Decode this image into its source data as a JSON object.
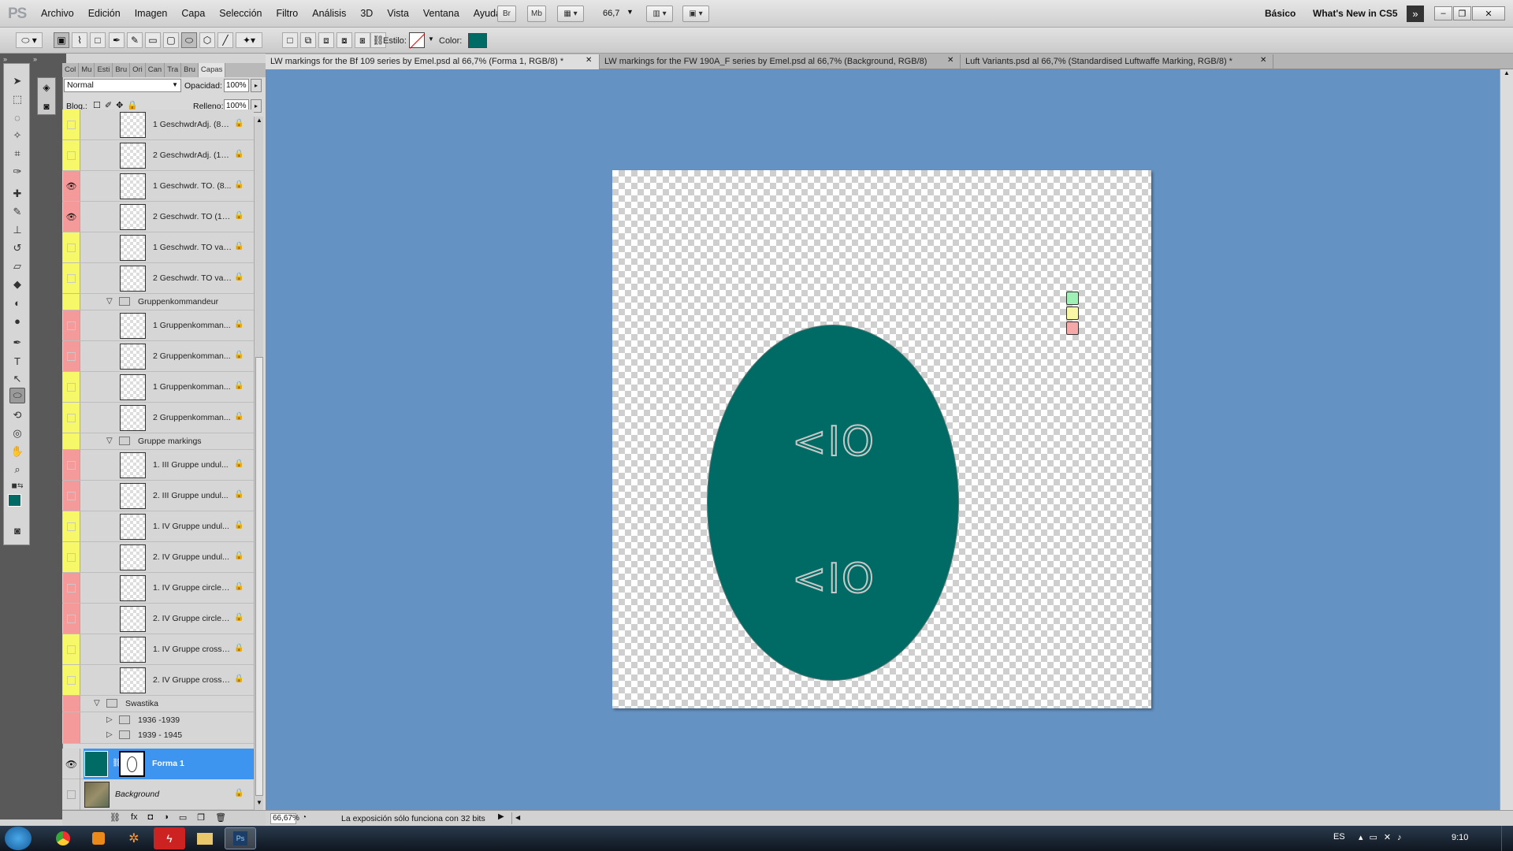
{
  "app": {
    "logo": "PS"
  },
  "menu": [
    "Archivo",
    "Edición",
    "Imagen",
    "Capa",
    "Selección",
    "Filtro",
    "Análisis",
    "3D",
    "Vista",
    "Ventana",
    "Ayuda"
  ],
  "menubar_buttons": {
    "bridge": "Br",
    "mini_bridge": "Mb",
    "zoom": "66,7"
  },
  "workspace": {
    "basic": "Básico",
    "whats_new": "What's New in CS5"
  },
  "options": {
    "style_label": "Estilo:",
    "color_label": "Color:",
    "color_value": "#006b64"
  },
  "panel": {
    "tabs": [
      "Col",
      "Mu",
      "Esti",
      "Bru",
      "Ori",
      "Can",
      "Tra",
      "Bru",
      "Capas"
    ],
    "blend_mode": "Normal",
    "opacity_label": "Opacidad:",
    "opacity_value": "100%",
    "lock_label": "Bloq.:",
    "fill_label": "Relleno:",
    "fill_value": "100%"
  },
  "layers": [
    {
      "name": "1 GeschwdrAdj. (85...",
      "color": "#f7f76a",
      "eye": false
    },
    {
      "name": "2 GeschwdrAdj. (15...",
      "color": "#f7f76a",
      "eye": false
    },
    {
      "name": "1 Geschwdr. TO. (8...",
      "color": "#f49a9a",
      "eye": true
    },
    {
      "name": "2 Geschwdr. TO (15...",
      "color": "#f49a9a",
      "eye": true
    },
    {
      "name": "1 Geschwdr. TO var...",
      "color": "#f7f76a",
      "eye": false
    },
    {
      "name": "2 Geschwdr. TO var...",
      "color": "#f7f76a",
      "eye": false
    }
  ],
  "group_gk": {
    "name": "Gruppenkommandeur",
    "color": "#f7f76a"
  },
  "layers_gk": [
    {
      "name": "1 Gruppenkomman...",
      "color": "#f49a9a"
    },
    {
      "name": "2 Gruppenkomman...",
      "color": "#f49a9a"
    },
    {
      "name": "1 Gruppenkomman...",
      "color": "#f7f76a"
    },
    {
      "name": "2 Gruppenkomman...",
      "color": "#f7f76a"
    }
  ],
  "group_gm": {
    "name": "Gruppe markings",
    "color": "#f7f76a"
  },
  "layers_gm": [
    {
      "name": "1. III Gruppe undul...",
      "color": "#f49a9a"
    },
    {
      "name": "2. III Gruppe undul...",
      "color": "#f49a9a"
    },
    {
      "name": "1. IV Gruppe undul...",
      "color": "#f7f76a"
    },
    {
      "name": "2. IV Gruppe undul...",
      "color": "#f7f76a"
    },
    {
      "name": "1. IV Gruppe circle (...",
      "color": "#f49a9a"
    },
    {
      "name": "2. IV Gruppe circle (...",
      "color": "#f49a9a"
    },
    {
      "name": "1. IV Gruppe cross (...",
      "color": "#f7f76a"
    },
    {
      "name": "2. IV Gruppe cross (...",
      "color": "#f7f76a"
    }
  ],
  "group_sw": {
    "name": "Swastika",
    "color": "#f49a9a"
  },
  "subgroups": [
    {
      "name": "1936 -1939",
      "color": "#f49a9a"
    },
    {
      "name": "1939 - 1945",
      "color": "#f49a9a"
    }
  ],
  "active_layer": {
    "name": "Forma 1"
  },
  "background_layer": {
    "name": "Background"
  },
  "doc_tabs": [
    "LW markings for the Bf 109 series by Emel.psd al 66,7% (Forma 1, RGB/8) *",
    "LW markings for the FW 190A_F series  by Emel.psd al 66,7% (Background, RGB/8)",
    "Luft Variants.psd al 66,7% (Standardised Luftwaffe Marking, RGB/8) *"
  ],
  "canvas": {
    "mark_top": "<IO",
    "mark_bottom": "<IO",
    "swatch_colors": [
      "#9ef0b4",
      "#f7f7a6",
      "#f4a8a8"
    ]
  },
  "status": {
    "zoom": "66,67%",
    "message": "La exposición sólo funciona con 32 bits"
  },
  "taskbar": {
    "lang": "ES",
    "time": "9:10"
  }
}
